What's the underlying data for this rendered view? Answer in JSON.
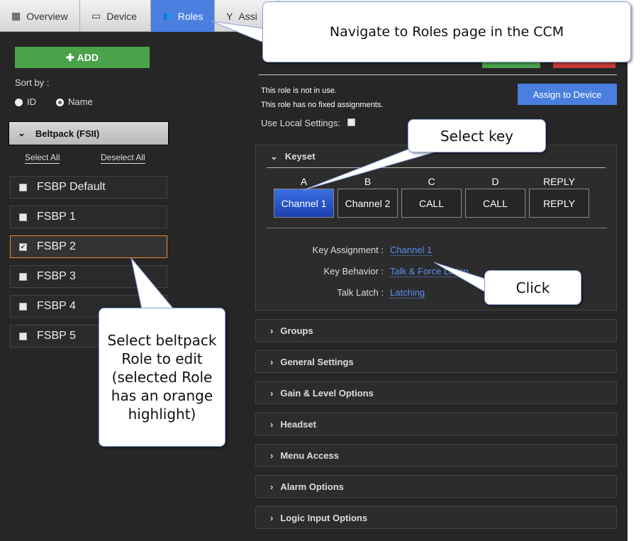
{
  "tabs": [
    {
      "label": "Overview",
      "icon": "grid-icon"
    },
    {
      "label": "Device",
      "icon": "device-icon"
    },
    {
      "label": "Roles",
      "icon": "users-icon",
      "active": true
    },
    {
      "label": "Assi",
      "icon": "assign-icon"
    }
  ],
  "sidebar": {
    "add_label": "ADD",
    "sort_label": "Sort by :",
    "sort_options": [
      "ID",
      "Name"
    ],
    "sort_selected": "Name",
    "group": "Beltpack (FSII)",
    "select_all": "Select All",
    "deselect_all": "Deselect All",
    "roles": [
      {
        "name": "FSBP Default",
        "checked": false
      },
      {
        "name": "FSBP 1",
        "checked": false
      },
      {
        "name": "FSBP 2",
        "checked": true
      },
      {
        "name": "FSBP 3",
        "checked": false
      },
      {
        "name": "FSBP 4",
        "checked": false
      },
      {
        "name": "FSBP 5",
        "checked": false
      }
    ]
  },
  "main": {
    "status1": "This role is not in use.",
    "status2": "This role has no fixed assignments.",
    "assign_button": "Assign to Device",
    "local_settings": "Use Local Settings:",
    "keyset": {
      "title": "Keyset",
      "keys": [
        {
          "label": "A",
          "value": "Channel 1"
        },
        {
          "label": "B",
          "value": "Channel 2"
        },
        {
          "label": "C",
          "value": "CALL"
        },
        {
          "label": "D",
          "value": "CALL"
        },
        {
          "label": "REPLY",
          "value": "REPLY"
        }
      ],
      "props": [
        {
          "label": "Key Assignment :",
          "value": "Channel 1"
        },
        {
          "label": "Key Behavior :",
          "value": "Talk & Force Listen"
        },
        {
          "label": "Talk Latch :",
          "value": "Latching"
        }
      ]
    },
    "sections": [
      "Groups",
      "General Settings",
      "Gain & Level Options",
      "Headset",
      "Menu Access",
      "Alarm Options",
      "Logic Input Options"
    ]
  },
  "callouts": {
    "nav": "Navigate to Roles page in the CCM",
    "key": "Select key",
    "click": "Click",
    "role": "Select beltpack Role to edit (selected Role has an orange highlight)"
  },
  "colors": {
    "accent": "#4a7fe0",
    "selected_key": "#1a3fb0",
    "highlight": "#f08a2c",
    "add": "#4aa34a",
    "link": "#5b8df0"
  }
}
